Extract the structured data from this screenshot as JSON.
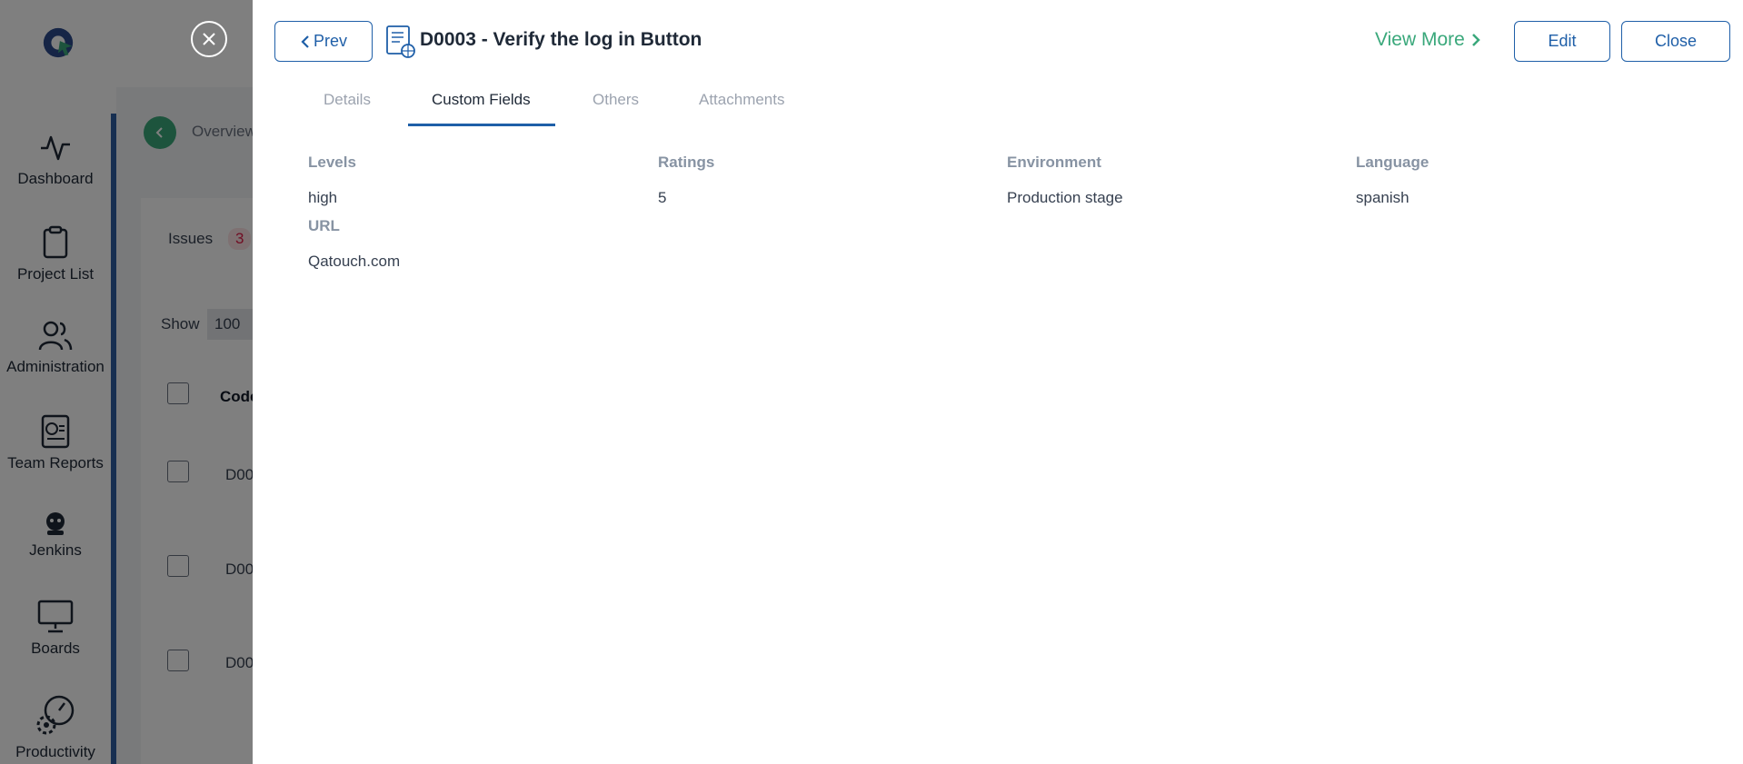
{
  "sidebar": {
    "items": [
      {
        "label": "Dashboard",
        "icon": "activity-icon"
      },
      {
        "label": "Project List",
        "icon": "clipboard-icon"
      },
      {
        "label": "Administration",
        "icon": "users-icon"
      },
      {
        "label": "Team Reports",
        "icon": "report-icon"
      },
      {
        "label": "Jenkins",
        "icon": "jenkins-icon"
      },
      {
        "label": "Boards",
        "icon": "board-icon"
      },
      {
        "label": "Productivity",
        "icon": "productivity-icon"
      }
    ]
  },
  "background": {
    "breadcrumb": "Overview",
    "issues_label": "Issues",
    "issues_count": "3",
    "show_label": "Show",
    "show_value": "100",
    "code_header": "Code",
    "rows": [
      "D00",
      "D00",
      "D00"
    ]
  },
  "panel": {
    "prev_label": "Prev",
    "title": "D0003 - Verify the log in Button",
    "view_more_label": "View More",
    "edit_label": "Edit",
    "close_label": "Close",
    "tabs": [
      "Details",
      "Custom Fields",
      "Others",
      "Attachments"
    ],
    "fields": [
      {
        "label": "Levels",
        "value": "high"
      },
      {
        "label": "Ratings",
        "value": "5"
      },
      {
        "label": "Environment",
        "value": "Production stage"
      },
      {
        "label": "Language",
        "value": "spanish"
      },
      {
        "label": "URL",
        "value": "Qatouch.com"
      }
    ]
  },
  "colors": {
    "accent": "#1f5fa8",
    "view_more": "#3aa87b",
    "sidebar_bar": "#2f5ea3"
  }
}
